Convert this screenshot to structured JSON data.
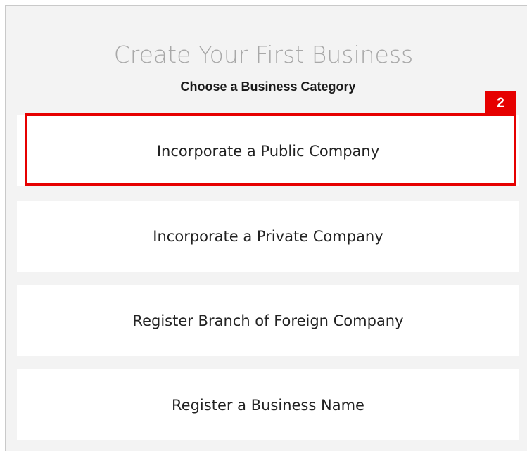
{
  "page": {
    "title": "Create Your First Business",
    "subtitle": "Choose a Business Category"
  },
  "categories": [
    {
      "label": "Incorporate a Public Company"
    },
    {
      "label": "Incorporate a Private Company"
    },
    {
      "label": "Register Branch of Foreign Company"
    },
    {
      "label": "Register a Business Name"
    }
  ],
  "annotation": {
    "step_number": "2",
    "color": "#e60000"
  }
}
